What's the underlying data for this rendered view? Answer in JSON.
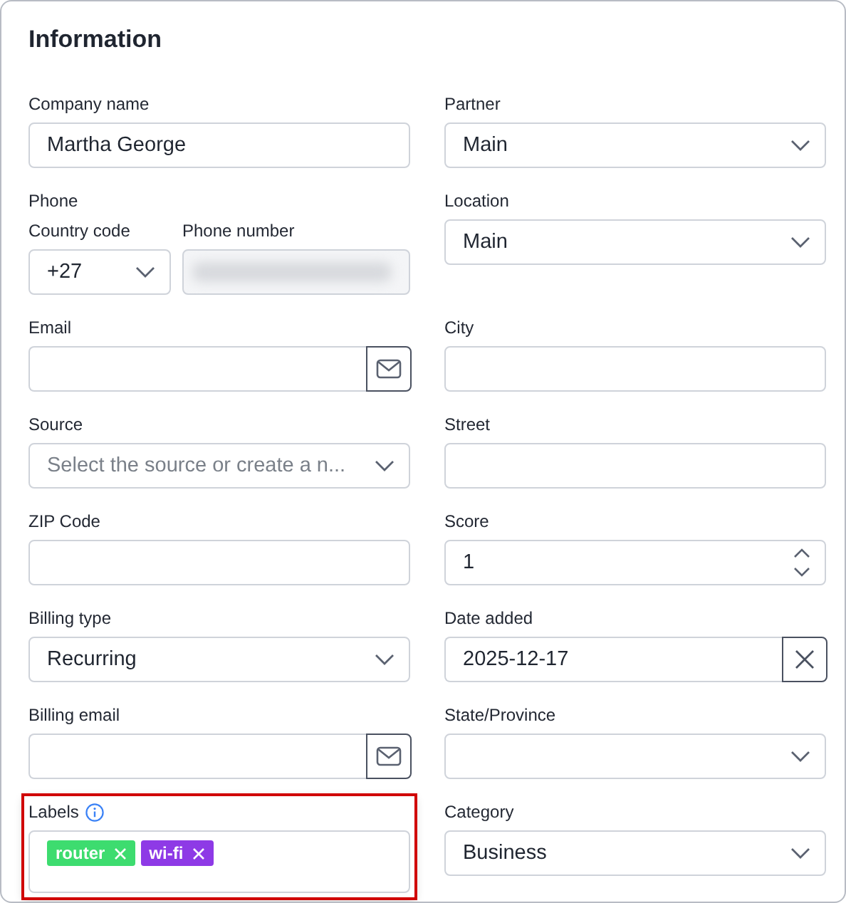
{
  "title": "Information",
  "rows": [
    {
      "left": {
        "kind": "text",
        "label": "Company name",
        "value": "Martha George"
      },
      "right": {
        "kind": "select",
        "label": "Partner",
        "value": "Main"
      }
    },
    {
      "left": {
        "kind": "phone",
        "label": "Phone",
        "code_label": "Country code",
        "code": "+27",
        "number_label": "Phone number",
        "number_blurred": true
      },
      "right": {
        "kind": "select",
        "label": "Location",
        "value": "Main"
      }
    },
    {
      "left": {
        "kind": "email",
        "label": "Email"
      },
      "right": {
        "kind": "text",
        "label": "City"
      }
    },
    {
      "left": {
        "kind": "select",
        "label": "Source",
        "placeholder": "Select the source or create a n..."
      },
      "right": {
        "kind": "text",
        "label": "Street"
      }
    },
    {
      "left": {
        "kind": "text",
        "label": "ZIP Code"
      },
      "right": {
        "kind": "number",
        "label": "Score",
        "value": "1"
      }
    },
    {
      "left": {
        "kind": "select",
        "label": "Billing type",
        "value": "Recurring"
      },
      "right": {
        "kind": "date",
        "label": "Date added",
        "value": "2025-12-17"
      }
    },
    {
      "left": {
        "kind": "email",
        "label": "Billing email"
      },
      "right": {
        "kind": "select",
        "label": "State/Province"
      }
    },
    {
      "left": {
        "kind": "tags",
        "label": "Labels",
        "info": true,
        "highlighted": true,
        "tags": [
          {
            "text": "router",
            "color": "#3ddc6f"
          },
          {
            "text": "wi-fi",
            "color": "#8e3ae6"
          }
        ]
      },
      "right": {
        "kind": "select",
        "label": "Category",
        "value": "Business"
      }
    }
  ]
}
